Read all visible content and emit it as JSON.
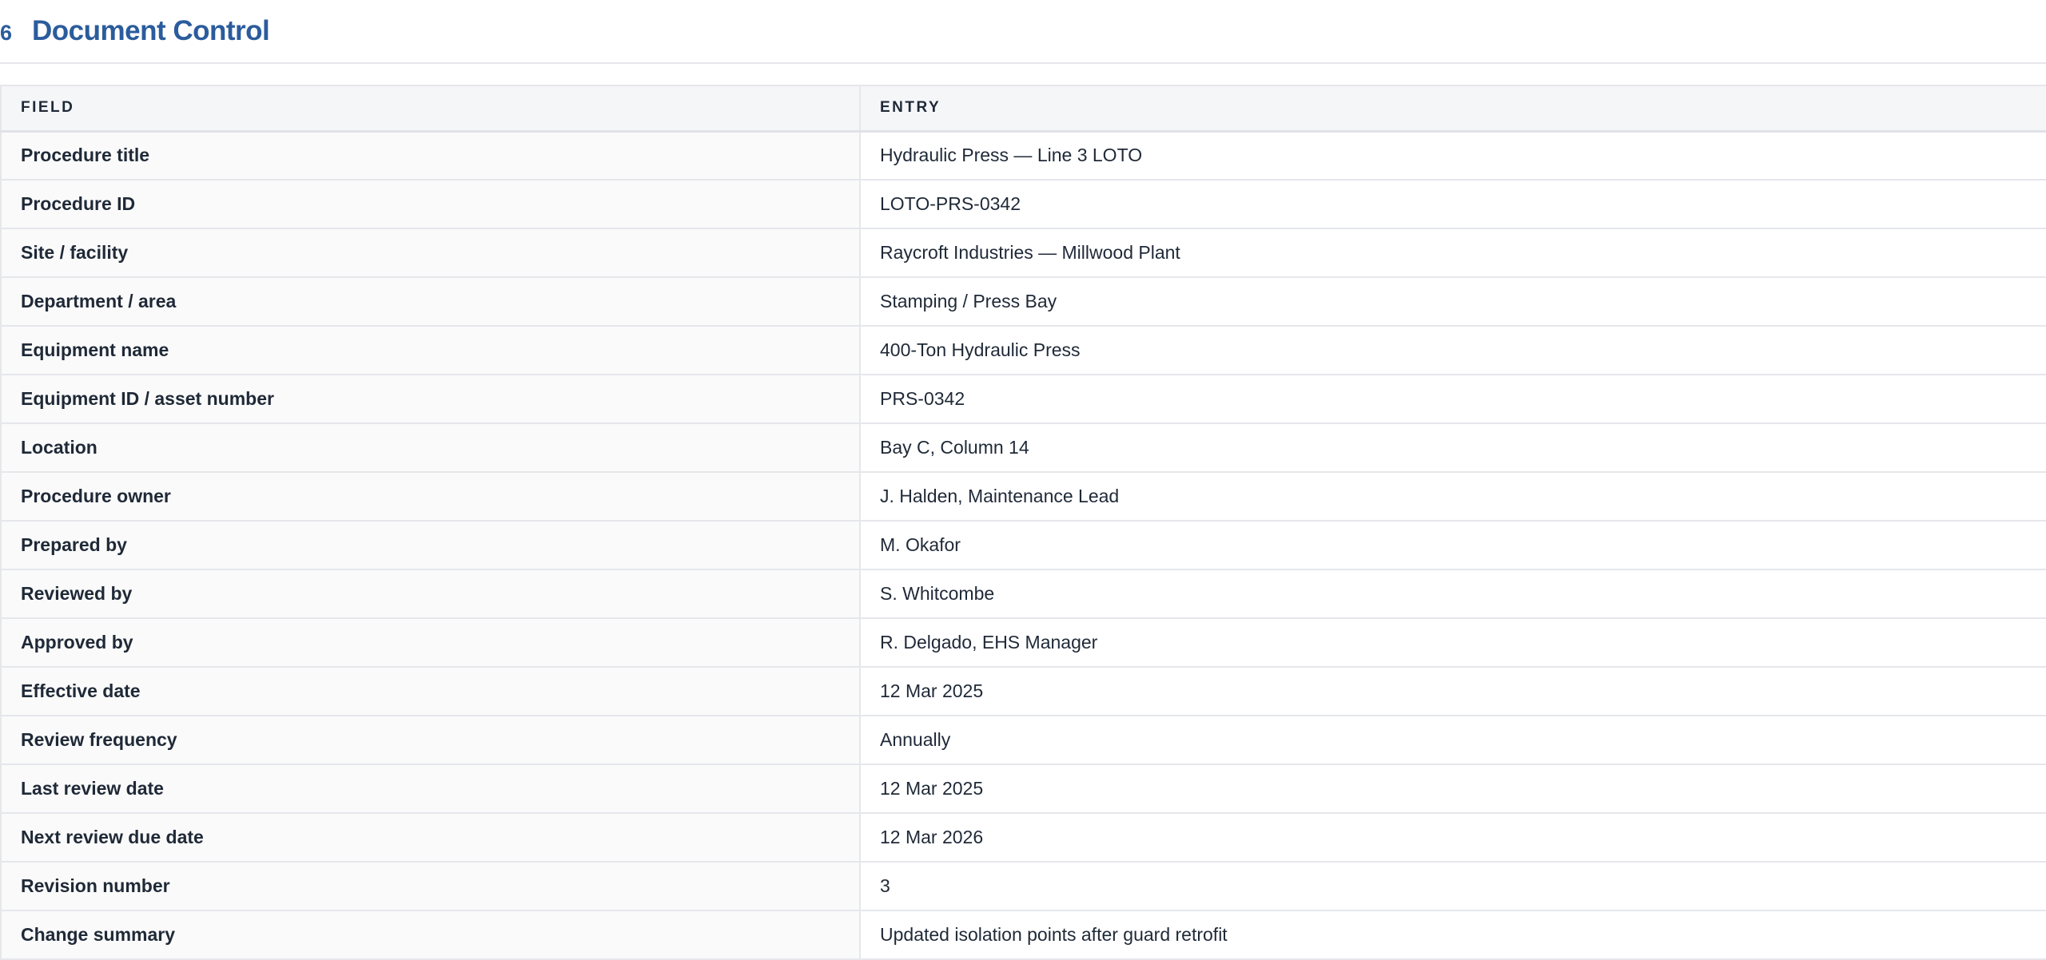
{
  "section": {
    "number": "6",
    "title": "Document Control"
  },
  "table": {
    "headers": {
      "field": "FIELD",
      "entry": "ENTRY"
    },
    "rows": [
      {
        "field": "Procedure title",
        "entry": "Hydraulic Press — Line 3 LOTO"
      },
      {
        "field": "Procedure ID",
        "entry": "LOTO-PRS-0342"
      },
      {
        "field": "Site / facility",
        "entry": "Raycroft Industries — Millwood Plant"
      },
      {
        "field": "Department / area",
        "entry": "Stamping / Press Bay"
      },
      {
        "field": "Equipment name",
        "entry": "400-Ton Hydraulic Press"
      },
      {
        "field": "Equipment ID / asset number",
        "entry": "PRS-0342"
      },
      {
        "field": "Location",
        "entry": "Bay C, Column 14"
      },
      {
        "field": "Procedure owner",
        "entry": "J. Halden, Maintenance Lead"
      },
      {
        "field": "Prepared by",
        "entry": "M. Okafor"
      },
      {
        "field": "Reviewed by",
        "entry": "S. Whitcombe"
      },
      {
        "field": "Approved by",
        "entry": "R. Delgado, EHS Manager"
      },
      {
        "field": "Effective date",
        "entry": "12 Mar 2025"
      },
      {
        "field": "Review frequency",
        "entry": "Annually"
      },
      {
        "field": "Last review date",
        "entry": "12 Mar 2025"
      },
      {
        "field": "Next review due date",
        "entry": "12 Mar 2026"
      },
      {
        "field": "Revision number",
        "entry": "3"
      },
      {
        "field": "Change summary",
        "entry": "Updated isolation points after guard retrofit"
      }
    ]
  },
  "colors": {
    "heading": "#2b5c9c",
    "header_bg": "#f5f6f8",
    "field_bg": "#fafafa",
    "border": "#e5e7eb",
    "text": "#1f2937"
  }
}
